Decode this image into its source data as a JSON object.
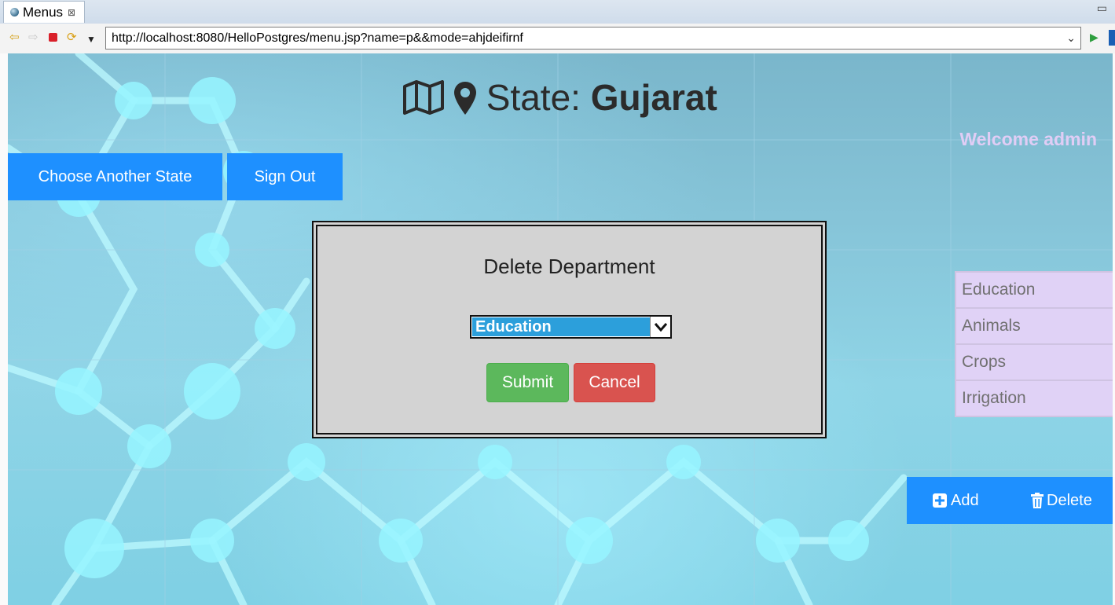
{
  "browser": {
    "tab_title": "Menus",
    "tab_close": "⊠",
    "url": "http://localhost:8080/HelloPostgres/menu.jsp?name=p&&mode=ahjdeifirnf",
    "minimize_glyph": "▭"
  },
  "header": {
    "state_label": "State: ",
    "state_name": "Gujarat",
    "welcome": "Welcome admin"
  },
  "buttons": {
    "choose_state": "Choose Another State",
    "sign_out": "Sign Out"
  },
  "dialog": {
    "title": "Delete Department",
    "selected_department": "Education",
    "submit": "Submit",
    "cancel": "Cancel"
  },
  "departments": [
    {
      "label": "Education"
    },
    {
      "label": "Animals"
    },
    {
      "label": "Crops"
    },
    {
      "label": "Irrigation"
    }
  ],
  "actions": {
    "add": "Add",
    "delete": "Delete"
  },
  "colors": {
    "primary_button": "#1e90ff",
    "submit": "#5cb85c",
    "cancel": "#d9534f",
    "list_bg": "#e0d2f6",
    "welcome_text": "#e0cdf5",
    "select_highlight": "#2c9fdb"
  },
  "icons": {
    "back": "back-arrow-icon",
    "forward": "forward-arrow-icon",
    "stop": "stop-icon",
    "refresh": "refresh-icon",
    "go": "go-icon",
    "title_map": "map-icon",
    "title_marker": "map-marker-icon",
    "add": "plus-square-icon",
    "delete": "trash-icon"
  }
}
